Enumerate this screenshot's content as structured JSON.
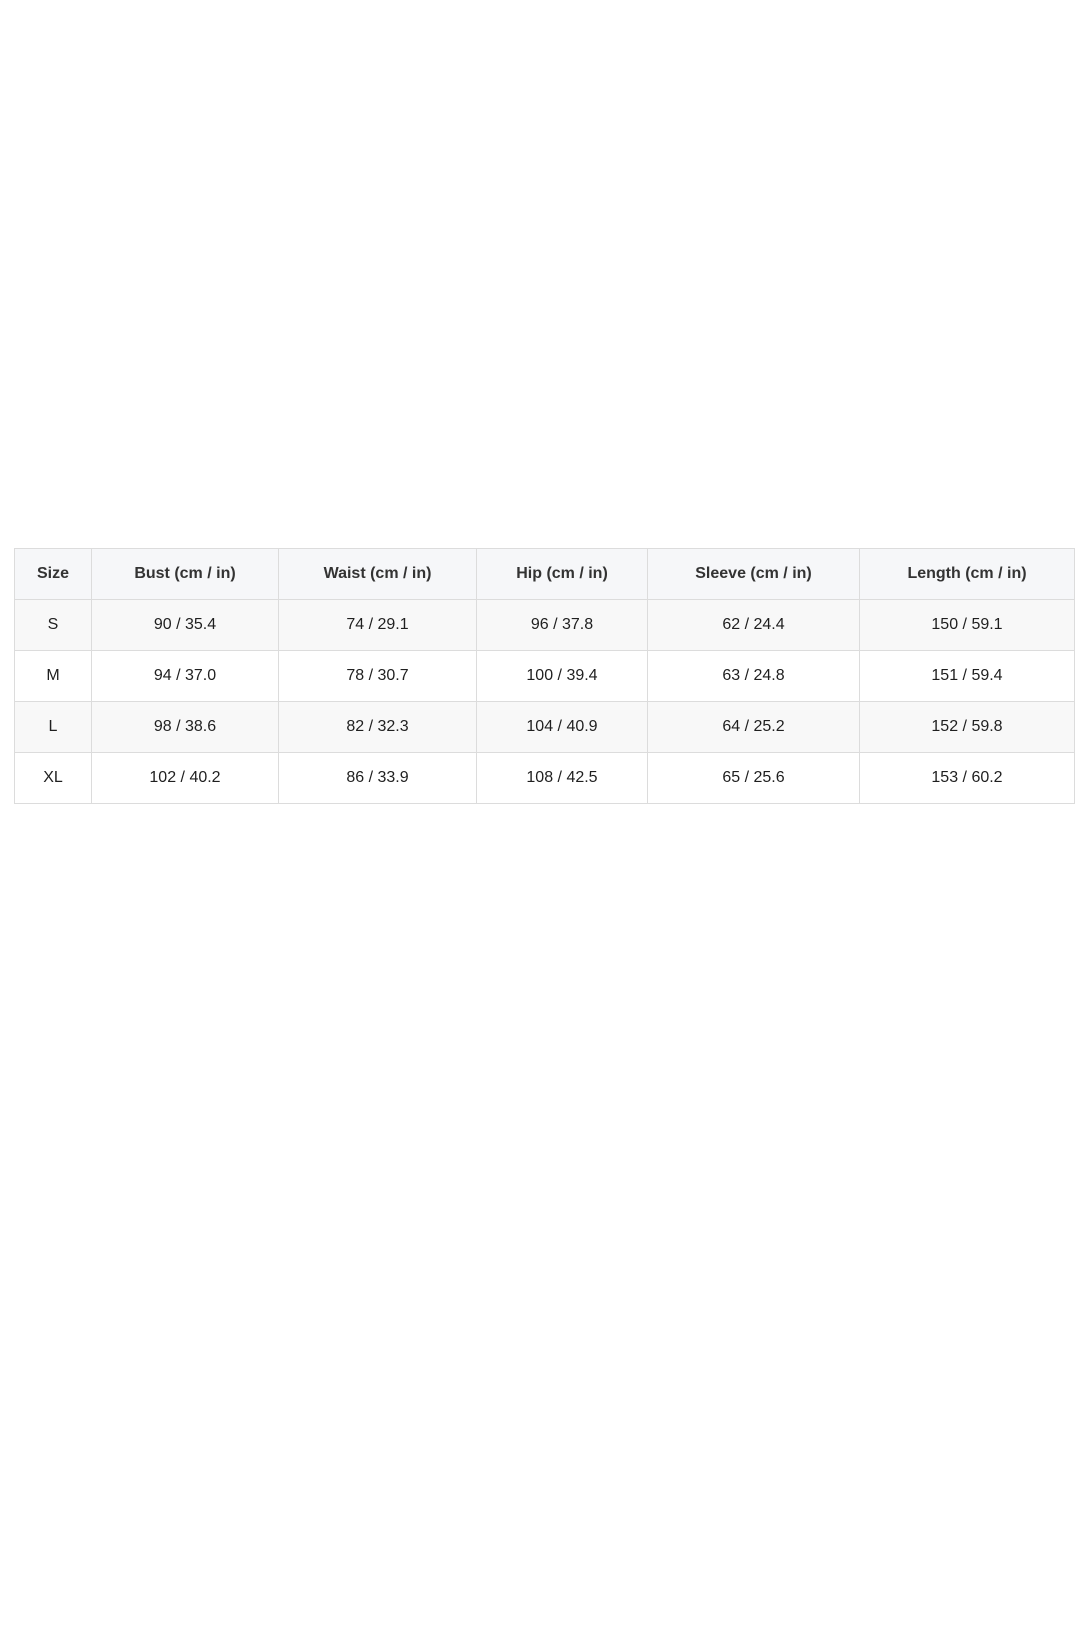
{
  "size_chart": {
    "headers": [
      "Size",
      "Bust (cm / in)",
      "Waist (cm / in)",
      "Hip (cm / in)",
      "Sleeve (cm / in)",
      "Length (cm / in)"
    ],
    "rows": [
      [
        "S",
        "90 / 35.4",
        "74 / 29.1",
        "96 / 37.8",
        "62 / 24.4",
        "150 / 59.1"
      ],
      [
        "M",
        "94 / 37.0",
        "78 / 30.7",
        "100 / 39.4",
        "63 / 24.8",
        "151 / 59.4"
      ],
      [
        "L",
        "98 / 38.6",
        "82 / 32.3",
        "104 / 40.9",
        "64 / 25.2",
        "152 / 59.8"
      ],
      [
        "XL",
        "102 / 40.2",
        "86 / 33.9",
        "108 / 42.5",
        "65 / 25.6",
        "153 / 60.2"
      ]
    ]
  }
}
